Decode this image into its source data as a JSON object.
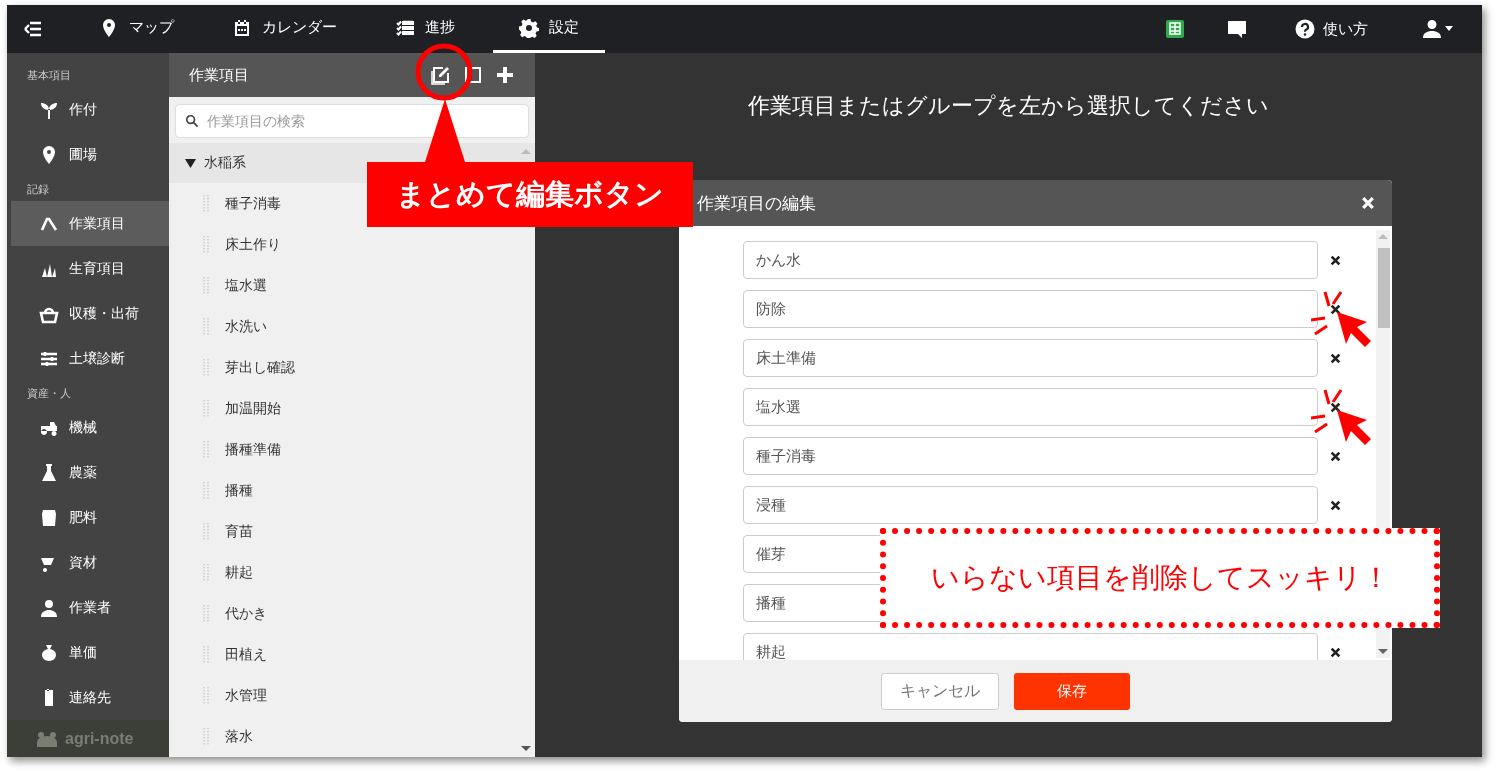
{
  "top_nav": {
    "tabs": [
      {
        "label": "マップ",
        "selected": false
      },
      {
        "label": "カレンダー",
        "selected": false
      },
      {
        "label": "進捗",
        "selected": false
      },
      {
        "label": "設定",
        "selected": true
      }
    ],
    "help": "使い方"
  },
  "sidebar": {
    "sections": [
      {
        "title": "基本項目",
        "items": [
          {
            "label": "作付",
            "selected": false
          },
          {
            "label": "圃場",
            "selected": false
          }
        ]
      },
      {
        "title": "記録",
        "items": [
          {
            "label": "作業項目",
            "selected": true
          },
          {
            "label": "生育項目",
            "selected": false
          },
          {
            "label": "収穫・出荷",
            "selected": false
          },
          {
            "label": "土壌診断",
            "selected": false
          }
        ]
      },
      {
        "title": "資産・人",
        "items": [
          {
            "label": "機械",
            "selected": false
          },
          {
            "label": "農薬",
            "selected": false
          },
          {
            "label": "肥料",
            "selected": false
          },
          {
            "label": "資材",
            "selected": false
          },
          {
            "label": "作業者",
            "selected": false
          },
          {
            "label": "単価",
            "selected": false
          },
          {
            "label": "連絡先",
            "selected": false
          }
        ]
      }
    ],
    "brand": "agri-note"
  },
  "list_panel": {
    "title": "作業項目",
    "search": {
      "placeholder": "作業項目の検索"
    },
    "groups": [
      {
        "label": "水稲系",
        "expanded": true,
        "children": [
          "種子消毒",
          "床土作り",
          "塩水選",
          "水洗い",
          "芽出し確認",
          "加温開始",
          "播種準備",
          "播種",
          "育苗",
          "耕起",
          "代かき",
          "田植え",
          "水管理",
          "落水"
        ]
      }
    ]
  },
  "main": {
    "prompt": "作業項目またはグループを左から選択してください"
  },
  "modal": {
    "title": "作業項目の編集",
    "fields": [
      {
        "value": "かん水",
        "pointed": false
      },
      {
        "value": "防除",
        "pointed": true
      },
      {
        "value": "床土準備",
        "pointed": false
      },
      {
        "value": "塩水選",
        "pointed": true
      },
      {
        "value": "種子消毒",
        "pointed": false
      },
      {
        "value": "浸種",
        "pointed": false
      },
      {
        "value": "催芽",
        "pointed": false
      },
      {
        "value": "播種",
        "pointed": false
      },
      {
        "value": "耕起",
        "pointed": false
      }
    ],
    "buttons": {
      "cancel": "キャンセル",
      "save": "保存"
    }
  },
  "annotations": {
    "callout": "まとめて編集ボタン",
    "note": "いらない項目を削除してスッキリ！"
  }
}
